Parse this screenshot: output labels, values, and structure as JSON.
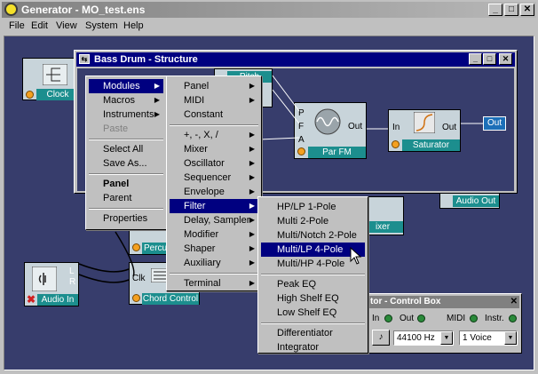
{
  "window": {
    "title": "Generator - MO_test.ens"
  },
  "menubar": [
    "File",
    "Edit",
    "View",
    "System",
    "Help"
  ],
  "structure_window": {
    "title": "Bass Drum - Structure"
  },
  "bg_modules": {
    "clock": "Clock",
    "audio_in": "Audio In",
    "audio_in_ports": [
      "L",
      "R"
    ],
    "chord_control": "Chord Control",
    "chord_port": "Clk",
    "percussion": "Percu",
    "mixer": "ixer",
    "audio_out": "Audio Out"
  },
  "struct_modules": {
    "parfm": {
      "label": "Par FM",
      "in_ports": [
        "P",
        "F",
        "A"
      ],
      "out_port": "Out"
    },
    "saturator": {
      "label": "Saturator",
      "in_port": "In",
      "out_port": "Out"
    },
    "out": {
      "label": "Out"
    },
    "partial_label": "Pitch"
  },
  "context_menu": [
    {
      "label": "Modules",
      "submenu": true,
      "selected": true
    },
    {
      "label": "Macros",
      "submenu": true
    },
    {
      "label": "Instruments",
      "submenu": true
    },
    {
      "label": "Paste",
      "disabled": true
    },
    {
      "label": "Select All"
    },
    {
      "label": "Save As..."
    },
    {
      "label": "Panel",
      "bold": true
    },
    {
      "label": "Parent"
    },
    {
      "label": "Properties"
    }
  ],
  "modules_menu": [
    {
      "label": "Panel",
      "submenu": true
    },
    {
      "label": "MIDI",
      "submenu": true
    },
    {
      "label": "Constant"
    },
    {
      "label": "+, -, X, /",
      "submenu": true
    },
    {
      "label": "Mixer",
      "submenu": true
    },
    {
      "label": "Oscillator",
      "submenu": true
    },
    {
      "label": "Sequencer",
      "submenu": true
    },
    {
      "label": "Envelope",
      "submenu": true
    },
    {
      "label": "Filter",
      "submenu": true,
      "selected": true
    },
    {
      "label": "Delay, Sampler",
      "submenu": true
    },
    {
      "label": "Modifier",
      "submenu": true
    },
    {
      "label": "Shaper",
      "submenu": true
    },
    {
      "label": "Auxiliary",
      "submenu": true
    },
    {
      "label": "Terminal",
      "submenu": true
    }
  ],
  "filter_menu": [
    {
      "label": "HP/LP 1-Pole"
    },
    {
      "label": "Multi 2-Pole"
    },
    {
      "label": "Multi/Notch 2-Pole"
    },
    {
      "label": "Multi/LP 4-Pole",
      "selected": true
    },
    {
      "label": "Multi/HP 4-Pole"
    },
    {
      "label": "Peak EQ"
    },
    {
      "label": "High Shelf EQ"
    },
    {
      "label": "Low Shelf EQ"
    },
    {
      "label": "Differentiator"
    },
    {
      "label": "Integrator"
    }
  ],
  "control_box": {
    "title": "tor - Control Box",
    "in_label": "In",
    "out_label": "Out",
    "midi_label": "MIDI",
    "instr_label": "Instr.",
    "sample_rate": "44100 Hz",
    "voices": "1 Voice"
  },
  "colors": {
    "workspace": "#373d6c",
    "module_label": "#1c8e8e",
    "selection": "#000080"
  }
}
